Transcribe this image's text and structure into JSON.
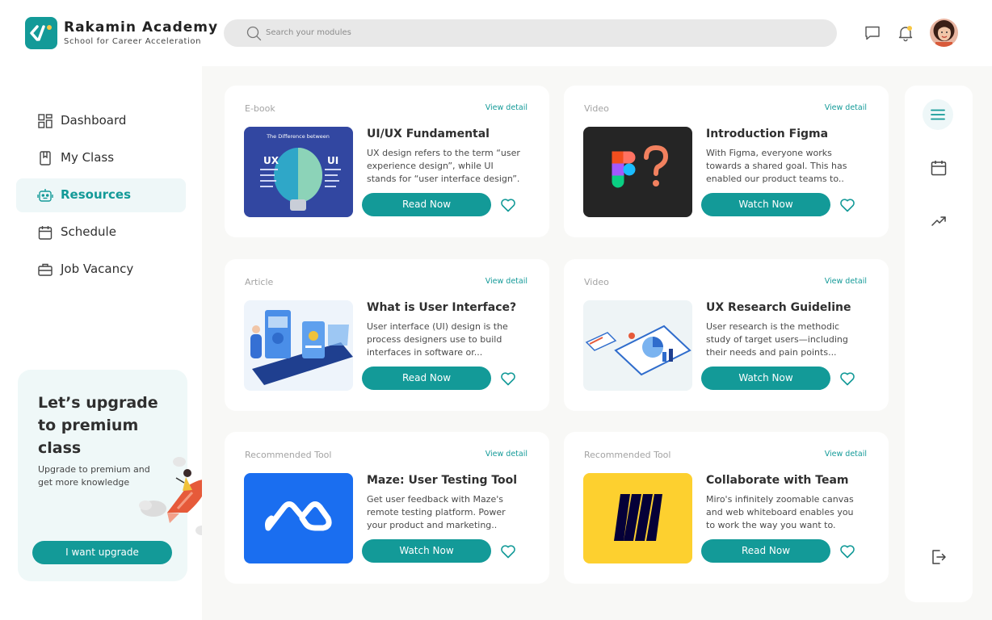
{
  "brand": {
    "name": "Rakamin Academy",
    "tagline": "School for Career Acceleration"
  },
  "search": {
    "placeholder": "Search your modules"
  },
  "header_icons": [
    "chat-icon",
    "bell-icon",
    "avatar"
  ],
  "sidebar": {
    "items": [
      {
        "label": "Dashboard",
        "icon": "grid-icon",
        "active": false
      },
      {
        "label": "My Class",
        "icon": "bookmark-icon",
        "active": false
      },
      {
        "label": "Resources",
        "icon": "robot-icon",
        "active": true
      },
      {
        "label": "Schedule",
        "icon": "calendar-icon",
        "active": false
      },
      {
        "label": "Job Vacancy",
        "icon": "briefcase-icon",
        "active": false
      }
    ]
  },
  "promo": {
    "title": "Let’s upgrade to premium class",
    "subtitle": "Upgrade to premium and get more knowledge",
    "button": "I want upgrade"
  },
  "cards": [
    {
      "category": "E-book",
      "view_detail": "View detail",
      "title": "UI/UX Fundamental",
      "description": "UX design refers to the term “user experience design”, while UI stands for “user interface design”.",
      "action": "Read Now",
      "thumb": "uiux-bulb"
    },
    {
      "category": "Video",
      "view_detail": "View detail",
      "title": "Introduction Figma",
      "description": "With Figma, everyone works towards a shared goal. This has enabled our product teams to..",
      "action": "Watch Now",
      "thumb": "figma-logo"
    },
    {
      "category": "Article",
      "view_detail": "View detail",
      "title": "What is User Interface?",
      "description": "User interface (UI) design is the process designers use to build interfaces in software or...",
      "action": "Read Now",
      "thumb": "ui-illustration"
    },
    {
      "category": "Video",
      "view_detail": "View detail",
      "title": "UX Research Guideline",
      "description": "User research is the methodic study of target users—including their needs and pain points...",
      "action": "Watch Now",
      "thumb": "research-illustration"
    },
    {
      "category": "Recommended Tool",
      "view_detail": "View detail",
      "title": "Maze: User Testing Tool",
      "description": "Get user feedback with Maze's remote testing platform. Power your product and marketing..",
      "action": "Watch Now",
      "thumb": "maze-logo"
    },
    {
      "category": "Recommended Tool",
      "view_detail": "View detail",
      "title": "Collaborate with Team",
      "description": "Miro's infinitely zoomable canvas and web whiteboard enables you to work the way you want to.",
      "action": "Read Now",
      "thumb": "miro-logo"
    }
  ],
  "thumb_texts": {
    "uiux_header": "The Difference between",
    "ux": "UX",
    "ui": "UI"
  },
  "rightbar": [
    "menu-icon",
    "calendar-icon",
    "trend-icon",
    "logout-icon"
  ],
  "colors": {
    "accent": "#139a98",
    "background": "#f8f8f6",
    "maze": "#1a6ef0",
    "miro": "#fdd02f",
    "figma_bg": "#252525"
  }
}
